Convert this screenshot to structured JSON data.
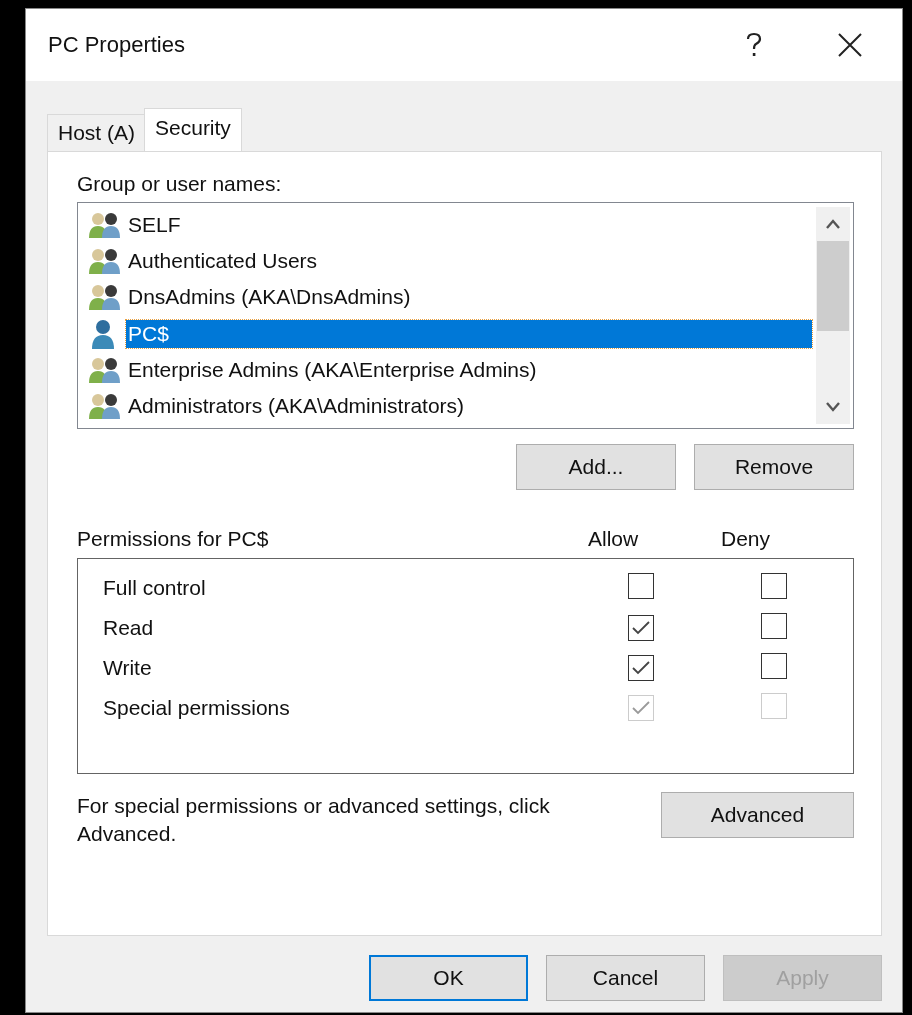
{
  "window": {
    "title": "PC Properties"
  },
  "tabs": [
    {
      "label": "Host (A)",
      "selected": false
    },
    {
      "label": "Security",
      "selected": true
    }
  ],
  "group_list": {
    "label": "Group or user names:",
    "items": [
      {
        "name": "SELF",
        "kind": "group",
        "selected": false
      },
      {
        "name": "Authenticated Users",
        "kind": "group",
        "selected": false
      },
      {
        "name": "DnsAdmins (AKA\\DnsAdmins)",
        "kind": "group",
        "selected": false
      },
      {
        "name": "PC$",
        "kind": "user",
        "selected": true
      },
      {
        "name": "Enterprise Admins (AKA\\Enterprise Admins)",
        "kind": "group",
        "selected": false
      },
      {
        "name": "Administrators (AKA\\Administrators)",
        "kind": "group",
        "selected": false
      }
    ]
  },
  "list_buttons": [
    {
      "label": "Add...",
      "disabled": false
    },
    {
      "label": "Remove",
      "disabled": false
    }
  ],
  "permissions": {
    "label": "Permissions for PC$",
    "columns": [
      "Allow",
      "Deny"
    ],
    "rows": [
      {
        "name": "Full control",
        "allow": {
          "checked": false,
          "disabled": false
        },
        "deny": {
          "checked": false,
          "disabled": false
        }
      },
      {
        "name": "Read",
        "allow": {
          "checked": true,
          "disabled": false
        },
        "deny": {
          "checked": false,
          "disabled": false
        }
      },
      {
        "name": "Write",
        "allow": {
          "checked": true,
          "disabled": false
        },
        "deny": {
          "checked": false,
          "disabled": false
        }
      },
      {
        "name": "Special permissions",
        "allow": {
          "checked": true,
          "disabled": true
        },
        "deny": {
          "checked": false,
          "disabled": true
        }
      }
    ]
  },
  "advanced": {
    "text": "For special permissions or advanced settings, click Advanced.",
    "button": "Advanced"
  },
  "buttons": [
    {
      "label": "OK",
      "default": true,
      "disabled": false
    },
    {
      "label": "Cancel",
      "default": false,
      "disabled": false
    },
    {
      "label": "Apply",
      "default": false,
      "disabled": true
    }
  ]
}
